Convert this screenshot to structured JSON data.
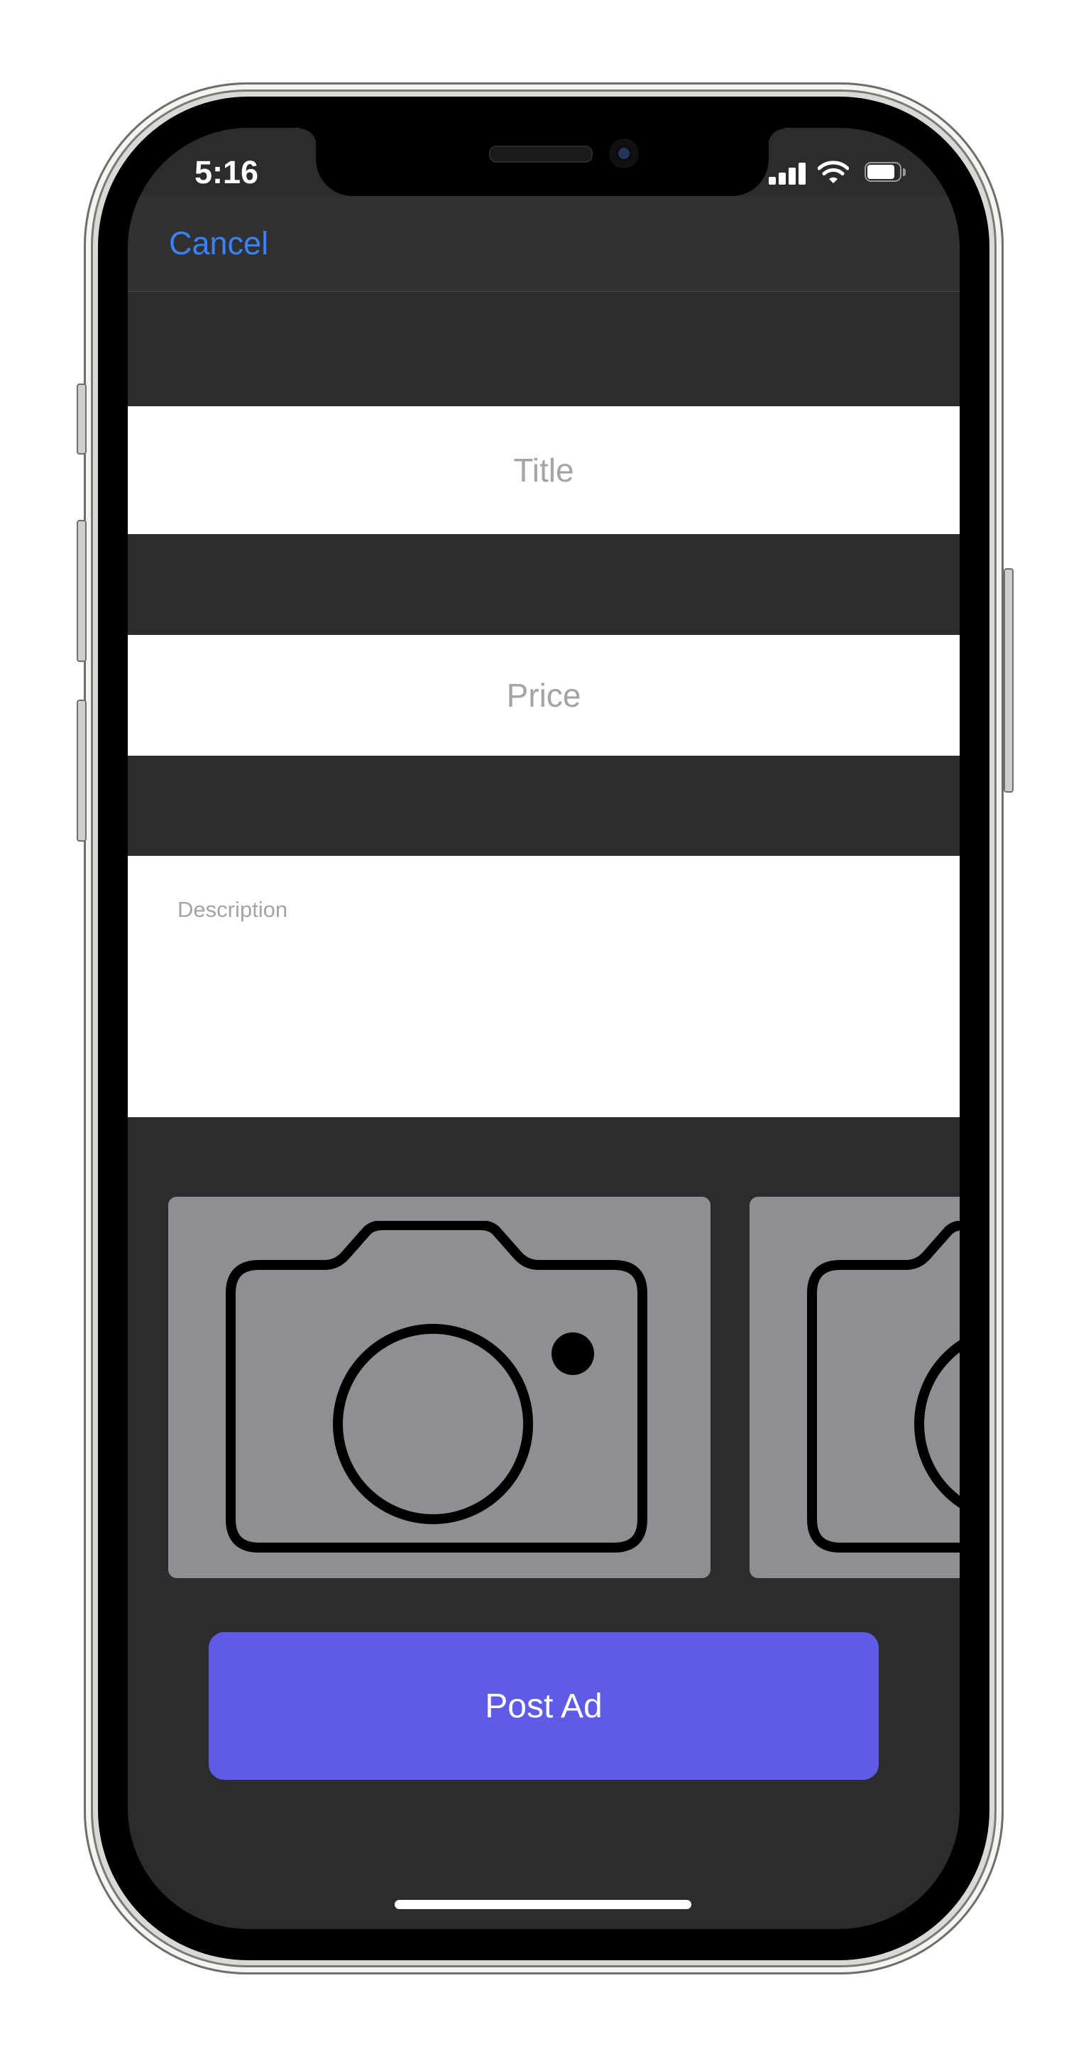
{
  "status_bar": {
    "time": "5:16",
    "icons": [
      "cellular-signal-icon",
      "wifi-icon",
      "battery-icon"
    ]
  },
  "nav": {
    "cancel_label": "Cancel"
  },
  "form": {
    "title_placeholder": "Title",
    "title_value": "",
    "price_placeholder": "Price",
    "price_value": "",
    "description_placeholder": "Description",
    "description_value": ""
  },
  "photos": {
    "icon": "camera-icon",
    "slot_count": 2
  },
  "actions": {
    "post_ad_label": "Post Ad"
  },
  "colors": {
    "background": "#2c2c2e",
    "link": "#3b82f6",
    "primary_button": "#5e5ce6",
    "photo_slot": "#8e8e93"
  }
}
